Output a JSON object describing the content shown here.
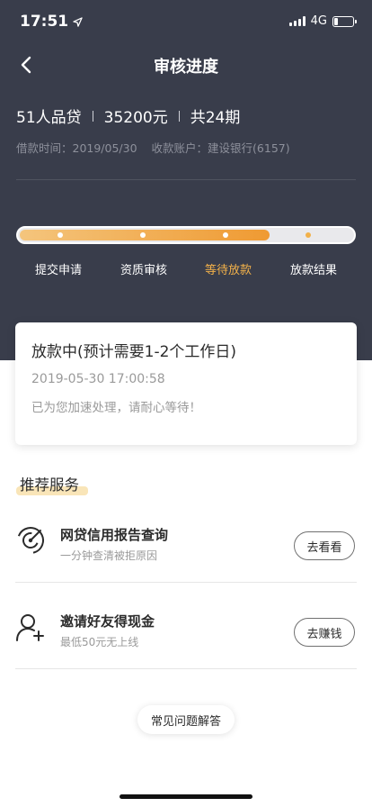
{
  "status_bar": {
    "time": "17:51",
    "network": "4G"
  },
  "nav": {
    "title": "审核进度"
  },
  "loan": {
    "product": "51人品贷",
    "amount": "35200元",
    "terms": "共24期",
    "date_text": "借款时间：2019/05/30",
    "account_text": "收款账户：建设银行(6157)"
  },
  "progress": {
    "fraction": 0.75,
    "steps": [
      {
        "label": "提交申请",
        "state": "done"
      },
      {
        "label": "资质审核",
        "state": "done"
      },
      {
        "label": "等待放款",
        "state": "active"
      },
      {
        "label": "放款结果",
        "state": "pending"
      }
    ]
  },
  "status_card": {
    "title": "放款中(预计需要1-2个工作日)",
    "time": "2019-05-30 17:00:58",
    "note": "已为您加速处理，请耐心等待！"
  },
  "services": {
    "section_title": "推荐服务",
    "items": [
      {
        "icon": "radar-icon",
        "title": "网贷信用报告查询",
        "subtitle": "一分钟查清被拒原因",
        "button": "去看看"
      },
      {
        "icon": "add-user-icon",
        "title": "邀请好友得现金",
        "subtitle": "最低50元无上线",
        "button": "去赚钱"
      }
    ]
  },
  "faq": {
    "label": "常见问题解答"
  },
  "colors": {
    "header_bg": "#393d4b",
    "accent": "#f2b14a"
  }
}
